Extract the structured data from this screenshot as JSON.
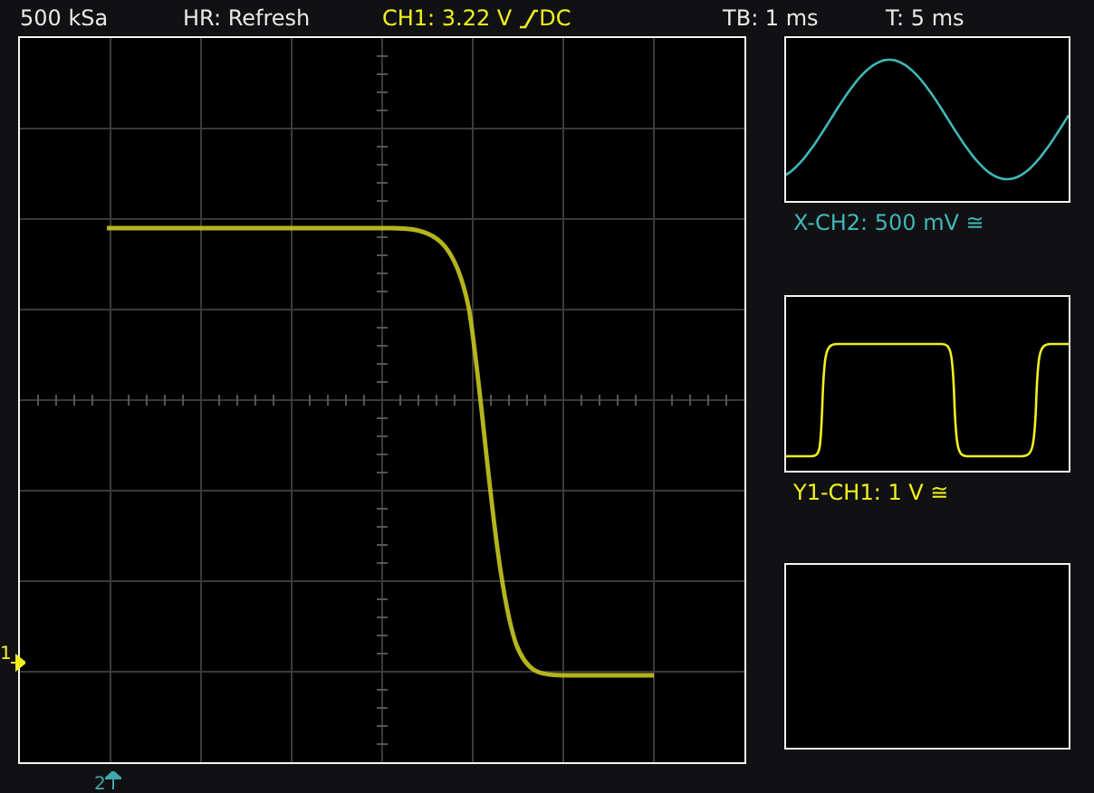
{
  "status_bar": {
    "sample_rate": "500 kSa",
    "mode": "HR: Refresh",
    "channel": {
      "text": "CH1: 3.22 V",
      "coupling": "DC",
      "color": "#f0f020"
    },
    "timebase": "TB: 1 ms",
    "trigger_time": "T: 5 ms"
  },
  "main_display": {
    "markers": [
      {
        "label": "1",
        "kind": "level",
        "color": "#f0f020"
      },
      {
        "label": "2",
        "kind": "trigger",
        "color": "#40a8a8"
      }
    ]
  },
  "side_panels": [
    {
      "kind": "sine",
      "label": "X-CH2: 500 mV ≅",
      "color": "#40b8b8"
    },
    {
      "kind": "square",
      "label": "Y1-CH1: 1 V ≅",
      "color": "#f0f020"
    },
    {
      "kind": "empty"
    }
  ]
}
